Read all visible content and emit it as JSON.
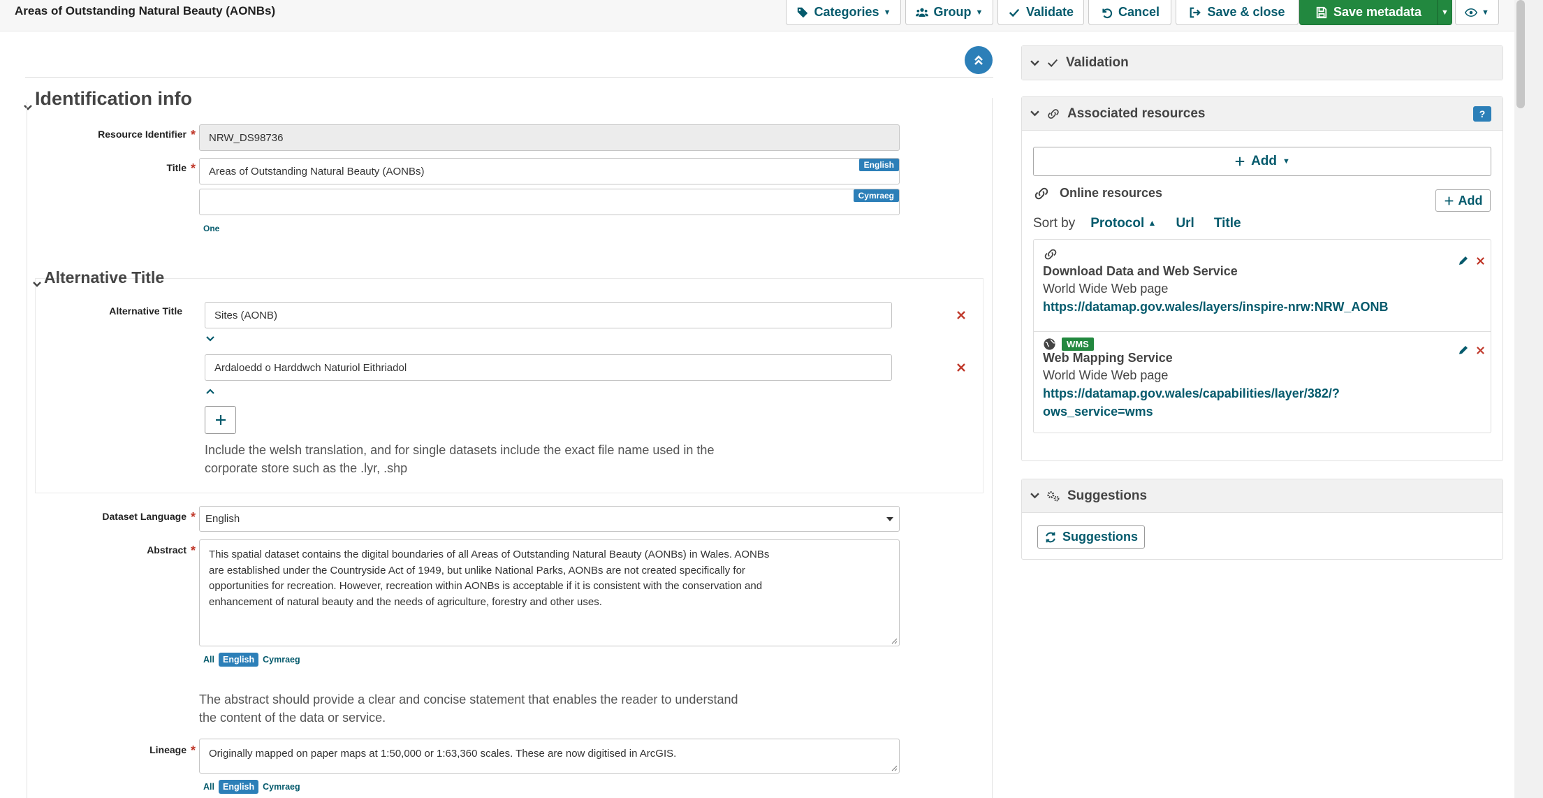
{
  "header": {
    "title": "Areas of Outstanding Natural Beauty (AONBs)",
    "buttons": {
      "categories": "Categories",
      "group": "Group",
      "validate": "Validate",
      "cancel": "Cancel",
      "save_close": "Save & close",
      "save_metadata": "Save metadata"
    }
  },
  "form": {
    "section_identification": "Identification info",
    "resource_identifier": {
      "label": "Resource Identifier",
      "value": "NRW_DS98736"
    },
    "title": {
      "label": "Title",
      "value_en": "Areas of Outstanding Natural Beauty (AONBs)",
      "value_cy": "",
      "tag_en": "English",
      "tag_cy": "Cymraeg",
      "one_link": "One"
    },
    "section_alternative": "Alternative Title",
    "alternative_title": {
      "label": "Alternative Title",
      "values": [
        "Sites (AONB)",
        "Ardaloedd o Harddwch Naturiol Eithriadol"
      ],
      "help": [
        "Include the welsh translation, and for single datasets include the exact file name used in the",
        "corporate store such as the .lyr, .shp"
      ]
    },
    "dataset_language": {
      "label": "Dataset Language",
      "value": "English"
    },
    "abstract": {
      "label": "Abstract",
      "lines": [
        "This spatial dataset contains the digital boundaries of all Areas of Outstanding Natural Beauty (AONBs) in Wales. AONBs",
        "are established under the Countryside Act of 1949, but unlike National Parks, AONBs are not created specifically for",
        "opportunities for recreation. However, recreation within AONBs is acceptable if it is consistent with the conservation and",
        "enhancement of natural beauty and the needs of agriculture, forestry and other uses."
      ],
      "lang_all": "All",
      "lang_en": "English",
      "lang_cy": "Cymraeg",
      "help": [
        "The abstract should provide a clear and concise statement that enables the reader to understand",
        "the content of the data or service."
      ]
    },
    "lineage": {
      "label": "Lineage",
      "value": "Originally mapped on paper maps at 1:50,000 or 1:63,360 scales. These are now digitised in ArcGIS.",
      "lang_all": "All",
      "lang_en": "English",
      "lang_cy": "Cymraeg"
    }
  },
  "panels": {
    "validation": {
      "title": "Validation"
    },
    "associated": {
      "title": "Associated resources",
      "help_badge": "?",
      "add_label": "Add",
      "online_title": "Online resources",
      "add_small": "Add",
      "sort_by": "Sort by",
      "sort_options": [
        "Protocol",
        "Url",
        "Title"
      ],
      "resources": [
        {
          "name": "Download Data and Web Service",
          "type": "World Wide Web page",
          "url_lines": [
            "https://datamap.gov.wales/layers/inspire-nrw:NRW_AONB"
          ]
        },
        {
          "badge": "WMS",
          "name": "Web Mapping Service",
          "type": "World Wide Web page",
          "url_lines": [
            "https://datamap.gov.wales/capabilities/layer/382/?",
            "ows_service=wms"
          ]
        }
      ]
    },
    "suggestions": {
      "title": "Suggestions",
      "button": "Suggestions"
    }
  }
}
